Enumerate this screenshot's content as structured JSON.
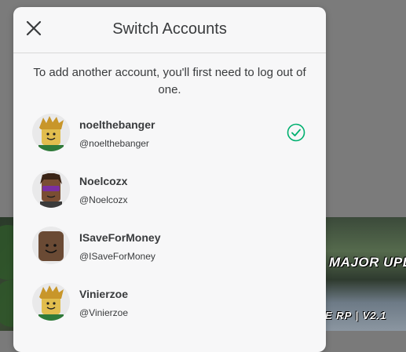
{
  "modal": {
    "title": "Switch Accounts",
    "description": "To add another account, you'll first need to log out of one."
  },
  "background": {
    "banner_top": "MAJOR UPD",
    "banner_bottom": "E RP | V2.1"
  },
  "accounts": [
    {
      "display_name": "noelthebanger",
      "username": "@noelthebanger",
      "active": true
    },
    {
      "display_name": "Noelcozx",
      "username": "@Noelcozx",
      "active": false
    },
    {
      "display_name": "ISaveForMoney",
      "username": "@ISaveForMoney",
      "active": false
    },
    {
      "display_name": "Vinierzoe",
      "username": "@Vinierzoe",
      "active": false
    }
  ],
  "colors": {
    "check": "#00b06f",
    "modal_bg": "#f7f7f8",
    "text": "#393b3d"
  },
  "icons": {
    "close": "close-icon",
    "active": "checkmark-circle-icon"
  }
}
